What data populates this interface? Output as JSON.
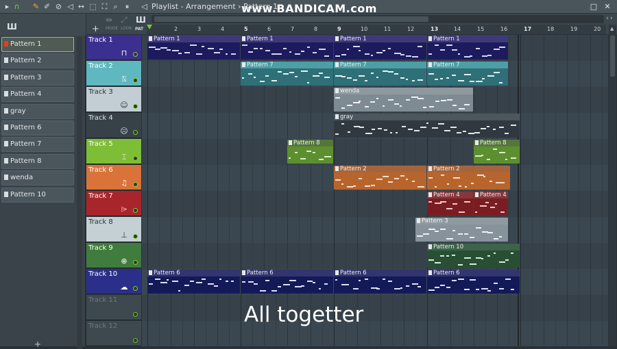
{
  "title_bar": {
    "title": "Playlist - Arrangement › Pattern 1",
    "watermark": "www.BANDICAM.com",
    "toolbar_icons": [
      "play-icon",
      "magnet-icon",
      "pencil-icon",
      "paint-icon",
      "delete-icon",
      "mute-icon",
      "slip-icon",
      "select-icon",
      "zoom-icon",
      "playback-icon",
      "speaker-icon"
    ],
    "window_buttons": [
      "□",
      "✕"
    ]
  },
  "picker": {
    "items": [
      {
        "label": "Pattern 1",
        "selected": true
      },
      {
        "label": "Pattern 2"
      },
      {
        "label": "Pattern 3"
      },
      {
        "label": "Pattern 4"
      },
      {
        "label": "gray"
      },
      {
        "label": "Pattern 6"
      },
      {
        "label": "Pattern 7"
      },
      {
        "label": "Pattern 8"
      },
      {
        "label": "wenda"
      },
      {
        "label": "Pattern 10"
      }
    ],
    "add_symbol": "+"
  },
  "header": {
    "add_symbol": "+",
    "mini_labels": [
      "MODE",
      "LOOK",
      "PAT"
    ],
    "bar_numbers": [
      "2",
      "3",
      "4",
      "5",
      "6",
      "7",
      "8",
      "9",
      "10",
      "11",
      "12",
      "13",
      "14",
      "15",
      "16",
      "17",
      "18",
      "19",
      "20"
    ]
  },
  "tracks": [
    {
      "name": "Track 1",
      "color": "#3b2f8f",
      "text": "#ffffff",
      "icon": "waveform-icon",
      "glyph": "⊓"
    },
    {
      "name": "Track 2",
      "color": "#5fb8c0",
      "text": "#ffffff",
      "icon": "piano-icon",
      "glyph": "⍂"
    },
    {
      "name": "Track 3",
      "color": "#c3ced4",
      "text": "#2b3338",
      "icon": "smile-icon",
      "glyph": "☺"
    },
    {
      "name": "Track 4",
      "color": "#364148",
      "text": "#dfe4e7",
      "icon": "sad-face-icon",
      "glyph": "☹"
    },
    {
      "name": "Track 5",
      "color": "#7ebd36",
      "text": "#ffffff",
      "icon": "tuning-fork-icon",
      "glyph": "⌶"
    },
    {
      "name": "Track 6",
      "color": "#d9733a",
      "text": "#ffffff",
      "icon": "guitar-icon",
      "glyph": "♫"
    },
    {
      "name": "Track 7",
      "color": "#a8262b",
      "text": "#ffffff",
      "icon": "drum-icon",
      "glyph": "⌲"
    },
    {
      "name": "Track 8",
      "color": "#c5d0d5",
      "text": "#2b3338",
      "icon": "metronome-icon",
      "glyph": "⊥"
    },
    {
      "name": "Track 9",
      "color": "#3f7c3d",
      "text": "#ffffff",
      "icon": "microphone-icon",
      "glyph": "⊕"
    },
    {
      "name": "Track 10",
      "color": "#2b2f8a",
      "text": "#ffffff",
      "icon": "cloud-icon",
      "glyph": "☁"
    },
    {
      "name": "Track 11",
      "color": "#3e484f",
      "text": "#6d7880",
      "icon": "",
      "glyph": ""
    },
    {
      "name": "Track 12",
      "color": "#3e484f",
      "text": "#6d7880",
      "icon": "",
      "glyph": ""
    }
  ],
  "clips": [
    {
      "track": 1,
      "start": 1,
      "end": 5,
      "label": "Pattern 1",
      "head": "#3e3a7a",
      "body": "#1d1b5e",
      "note": "#d7d9f0"
    },
    {
      "track": 1,
      "start": 5,
      "end": 9,
      "label": "Pattern 1",
      "head": "#3e3a7a",
      "body": "#1d1b5e",
      "note": "#d7d9f0"
    },
    {
      "track": 1,
      "start": 9,
      "end": 13,
      "label": "Pattern 1",
      "head": "#3e3a7a",
      "body": "#1d1b5e",
      "note": "#d7d9f0"
    },
    {
      "track": 1,
      "start": 13,
      "end": 16.5,
      "label": "Pattern 1",
      "head": "#3e3a7a",
      "body": "#1d1b5e",
      "note": "#d7d9f0"
    },
    {
      "track": 2,
      "start": 5,
      "end": 9,
      "label": "Pattern 7",
      "head": "#4d9ea5",
      "body": "#2e6f78",
      "note": "#e5f5f6"
    },
    {
      "track": 2,
      "start": 9,
      "end": 13,
      "label": "Pattern 7",
      "head": "#4d9ea5",
      "body": "#2e6f78",
      "note": "#e5f5f6"
    },
    {
      "track": 2,
      "start": 13,
      "end": 16.5,
      "label": "Pattern 7",
      "head": "#4d9ea5",
      "body": "#2e6f78",
      "note": "#e5f5f6"
    },
    {
      "track": 3,
      "start": 9,
      "end": 15,
      "label": "wenda",
      "head": "#8e999f",
      "body": "#7f8b92",
      "note": "#eef1f3"
    },
    {
      "track": 4,
      "start": 9,
      "end": 17,
      "label": "gray",
      "head": "#4b565d",
      "body": "#2f393f",
      "note": "#e4e8ea"
    },
    {
      "track": 5,
      "start": 7,
      "end": 9,
      "label": "Pattern 8",
      "head": "#55753d",
      "body": "#5c8f2f",
      "note": "#dff0c8"
    },
    {
      "track": 5,
      "start": 15,
      "end": 17,
      "label": "Pattern 8",
      "head": "#55753d",
      "body": "#5c8f2f",
      "note": "#dff0c8"
    },
    {
      "track": 6,
      "start": 9,
      "end": 13,
      "label": "Pattern 2",
      "head": "#a5653c",
      "body": "#b8652d",
      "note": "#f7e1cf"
    },
    {
      "track": 6,
      "start": 13,
      "end": 16.6,
      "label": "Pattern 2",
      "head": "#a5653c",
      "body": "#b8652d",
      "note": "#f7e1cf"
    },
    {
      "track": 7,
      "start": 13,
      "end": 15,
      "label": "Pattern 4",
      "head": "#85373a",
      "body": "#7a1d22",
      "note": "#f2c9ca"
    },
    {
      "track": 7,
      "start": 15,
      "end": 16.5,
      "label": "Pattern 4",
      "head": "#85373a",
      "body": "#7a1d22",
      "note": "#f2c9ca"
    },
    {
      "track": 8,
      "start": 12.5,
      "end": 16.5,
      "label": "Pattern 3",
      "head": "#8f9aa0",
      "body": "#87939a",
      "note": "#eef1f3"
    },
    {
      "track": 9,
      "start": 13,
      "end": 17,
      "label": "Pattern 10",
      "head": "#3d6448",
      "body": "#284f33",
      "note": "#d5eed9"
    },
    {
      "track": 10,
      "start": 1,
      "end": 5,
      "label": "Pattern 6",
      "head": "#32356e",
      "body": "#141a58",
      "note": "#dfe1f5"
    },
    {
      "track": 10,
      "start": 5,
      "end": 9,
      "label": "Pattern 6",
      "head": "#32356e",
      "body": "#141a58",
      "note": "#dfe1f5"
    },
    {
      "track": 10,
      "start": 9,
      "end": 13,
      "label": "Pattern 6",
      "head": "#32356e",
      "body": "#141a58",
      "note": "#dfe1f5"
    },
    {
      "track": 10,
      "start": 13,
      "end": 17,
      "label": "Pattern 6",
      "head": "#32356e",
      "body": "#141a58",
      "note": "#dfe1f5"
    }
  ],
  "caption": "All togetter"
}
